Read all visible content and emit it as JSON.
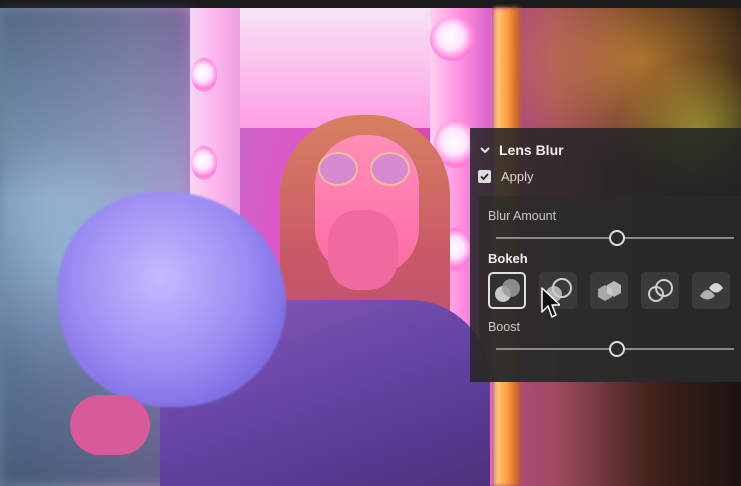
{
  "panel": {
    "title": "Lens Blur",
    "apply_label": "Apply",
    "apply_checked": true,
    "blur_amount_label": "Blur Amount",
    "blur_amount_value": 0.51,
    "bokeh_label": "Bokeh",
    "bokeh_options": [
      {
        "icon": "bokeh-circle-icon",
        "selected": true
      },
      {
        "icon": "bokeh-bubble-icon",
        "selected": false
      },
      {
        "icon": "bokeh-blade-icon",
        "selected": false
      },
      {
        "icon": "bokeh-ring-icon",
        "selected": false
      },
      {
        "icon": "bokeh-cat-eye-icon",
        "selected": false
      }
    ],
    "boost_label": "Boost",
    "boost_value": 0.51
  },
  "colors": {
    "panel_bg": "#262626",
    "text": "#e6e6e6",
    "track": "#8a8a8a"
  }
}
